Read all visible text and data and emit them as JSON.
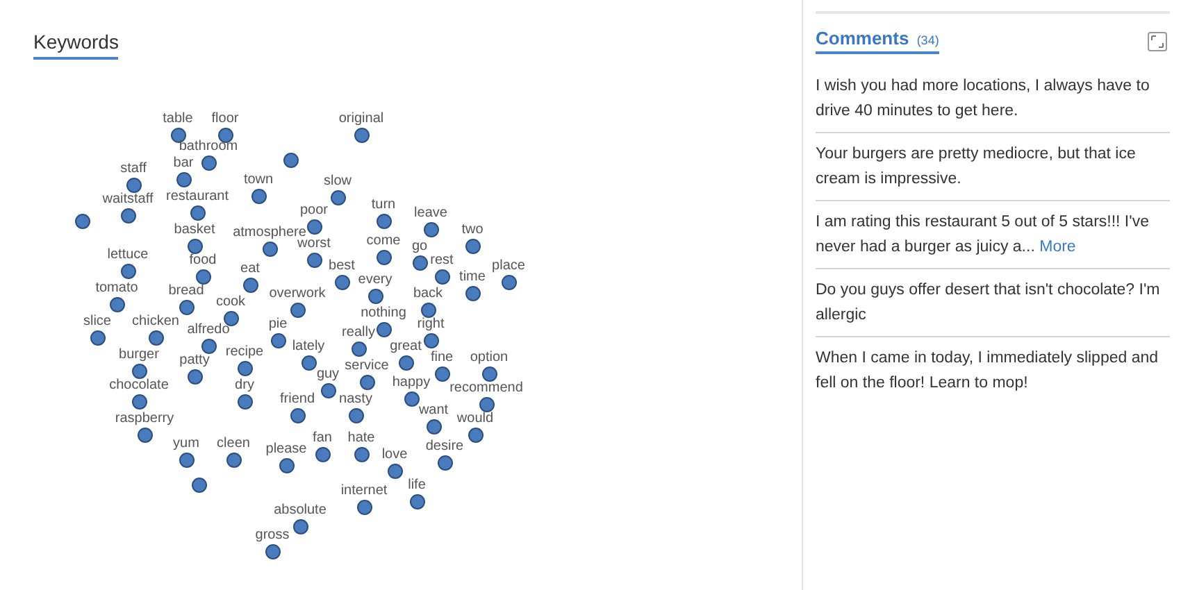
{
  "keywords": {
    "title": "Keywords",
    "points": [
      {
        "kind": "keyword",
        "label": "table"
      },
      {
        "kind": "keyword",
        "label": "floor"
      },
      {
        "kind": "keyword",
        "label": "bathroom"
      },
      {
        "kind": "keyword",
        "label": "original"
      },
      {
        "kind": "dot"
      },
      {
        "kind": "keyword",
        "label": "staff"
      },
      {
        "kind": "keyword",
        "label": "bar"
      },
      {
        "kind": "keyword",
        "label": "town"
      },
      {
        "kind": "keyword",
        "label": "waitstaff"
      },
      {
        "kind": "keyword",
        "label": "restaurant"
      },
      {
        "kind": "dot"
      },
      {
        "kind": "keyword",
        "label": "slow"
      },
      {
        "kind": "keyword",
        "label": "poor"
      },
      {
        "kind": "keyword",
        "label": "turn"
      },
      {
        "kind": "keyword",
        "label": "leave"
      },
      {
        "kind": "keyword",
        "label": "two"
      },
      {
        "kind": "keyword",
        "label": "worst"
      },
      {
        "kind": "keyword",
        "label": "best"
      },
      {
        "kind": "keyword",
        "label": "come"
      },
      {
        "kind": "keyword",
        "label": "go"
      },
      {
        "kind": "keyword",
        "label": "rest"
      },
      {
        "kind": "keyword",
        "label": "basket"
      },
      {
        "kind": "keyword",
        "label": "atmosphere"
      },
      {
        "kind": "keyword",
        "label": "lettuce"
      },
      {
        "kind": "keyword",
        "label": "food"
      },
      {
        "kind": "keyword",
        "label": "tomato"
      },
      {
        "kind": "keyword",
        "label": "bread"
      },
      {
        "kind": "keyword",
        "label": "slice"
      },
      {
        "kind": "keyword",
        "label": "chicken"
      },
      {
        "kind": "keyword",
        "label": "burger"
      },
      {
        "kind": "keyword",
        "label": "patty"
      },
      {
        "kind": "keyword",
        "label": "alfredo"
      },
      {
        "kind": "keyword",
        "label": "eat"
      },
      {
        "kind": "keyword",
        "label": "cook"
      },
      {
        "kind": "keyword",
        "label": "overwork"
      },
      {
        "kind": "keyword",
        "label": "pie"
      },
      {
        "kind": "keyword",
        "label": "recipe"
      },
      {
        "kind": "keyword",
        "label": "chocolate"
      },
      {
        "kind": "keyword",
        "label": "raspberry"
      },
      {
        "kind": "keyword",
        "label": "dry"
      },
      {
        "kind": "keyword",
        "label": "yum"
      },
      {
        "kind": "keyword",
        "label": "cleen"
      },
      {
        "kind": "keyword",
        "label": "please"
      },
      {
        "kind": "dot"
      },
      {
        "kind": "keyword",
        "label": "every"
      },
      {
        "kind": "keyword",
        "label": "nothing"
      },
      {
        "kind": "keyword",
        "label": "lately"
      },
      {
        "kind": "keyword",
        "label": "really"
      },
      {
        "kind": "keyword",
        "label": "great"
      },
      {
        "kind": "keyword",
        "label": "service"
      },
      {
        "kind": "keyword",
        "label": "happy"
      },
      {
        "kind": "keyword",
        "label": "guy"
      },
      {
        "kind": "keyword",
        "label": "friend"
      },
      {
        "kind": "keyword",
        "label": "nasty"
      },
      {
        "kind": "keyword",
        "label": "back"
      },
      {
        "kind": "keyword",
        "label": "right"
      },
      {
        "kind": "keyword",
        "label": "fine"
      },
      {
        "kind": "keyword",
        "label": "time"
      },
      {
        "kind": "keyword",
        "label": "place"
      },
      {
        "kind": "keyword",
        "label": "option"
      },
      {
        "kind": "keyword",
        "label": "recommend"
      },
      {
        "kind": "keyword",
        "label": "want"
      },
      {
        "kind": "keyword",
        "label": "would"
      },
      {
        "kind": "keyword",
        "label": "fan"
      },
      {
        "kind": "keyword",
        "label": "hate"
      },
      {
        "kind": "keyword",
        "label": "love"
      },
      {
        "kind": "keyword",
        "label": "desire"
      },
      {
        "kind": "keyword",
        "label": "life"
      },
      {
        "kind": "keyword",
        "label": "internet"
      },
      {
        "kind": "keyword",
        "label": "absolute"
      },
      {
        "kind": "keyword",
        "label": "gross"
      }
    ]
  },
  "comments": {
    "title": "Comments",
    "count": "(34)",
    "items": [
      {
        "text": "I wish you had more locations, I always have to drive 40 minutes to get here."
      },
      {
        "text": "Your burgers are pretty mediocre, but that ice cream is impressive."
      },
      {
        "text": "I am rating this restaurant 5 out of 5 stars!!! I've never had a burger as juicy a...",
        "link": "More"
      },
      {
        "text": "Do you guys offer desert that isn't chocolate? I'm allergic"
      },
      {
        "text": "When I came in today, I immediately slipped and fell on the floor! Learn to mop!"
      }
    ]
  }
}
